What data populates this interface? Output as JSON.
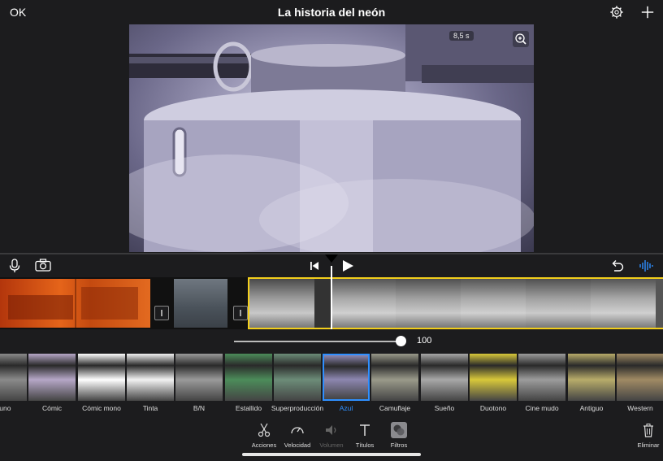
{
  "header": {
    "ok_label": "OK",
    "title": "La historia del neón",
    "settings_icon": "gear-icon",
    "add_icon": "plus-icon"
  },
  "viewer": {
    "duration_badge": "8,5 s",
    "zoom_icon": "zoom-in-icon"
  },
  "transport": {
    "mic_icon": "microphone-icon",
    "camera_icon": "camera-icon",
    "skip_back_icon": "skip-to-start-icon",
    "play_icon": "play-icon",
    "undo_icon": "undo-icon",
    "audio_icon": "audio-waveform-icon"
  },
  "slider": {
    "value": "100",
    "fraction": 1.0
  },
  "filters": {
    "items": [
      {
        "label": "guno",
        "tone": "#8a8a8a"
      },
      {
        "label": "Cómic",
        "tone": "#b6a7c7"
      },
      {
        "label": "Cómic mono",
        "tone": "#ffffff"
      },
      {
        "label": "Tinta",
        "tone": "#f2f2f2"
      },
      {
        "label": "B/N",
        "tone": "#9a9a9a"
      },
      {
        "label": "Estallido",
        "tone": "#4c8c5a"
      },
      {
        "label": "Superproducción",
        "tone": "#6c8c78"
      },
      {
        "label": "Azul",
        "tone": "#8c86b0"
      },
      {
        "label": "Camuflaje",
        "tone": "#9a9a8a"
      },
      {
        "label": "Sueño",
        "tone": "#a8a8a8"
      },
      {
        "label": "Duotono",
        "tone": "#d8c83a"
      },
      {
        "label": "Cine mudo",
        "tone": "#9c9c9c"
      },
      {
        "label": "Antiguo",
        "tone": "#b8ac6a"
      },
      {
        "label": "Western",
        "tone": "#a08a64"
      }
    ],
    "selected": "Azul"
  },
  "toolbar": {
    "acciones": "Acciones",
    "velocidad": "Velocidad",
    "volumen": "Volumen",
    "titulos": "Títulos",
    "filtros": "Filtros",
    "eliminar": "Eliminar"
  }
}
